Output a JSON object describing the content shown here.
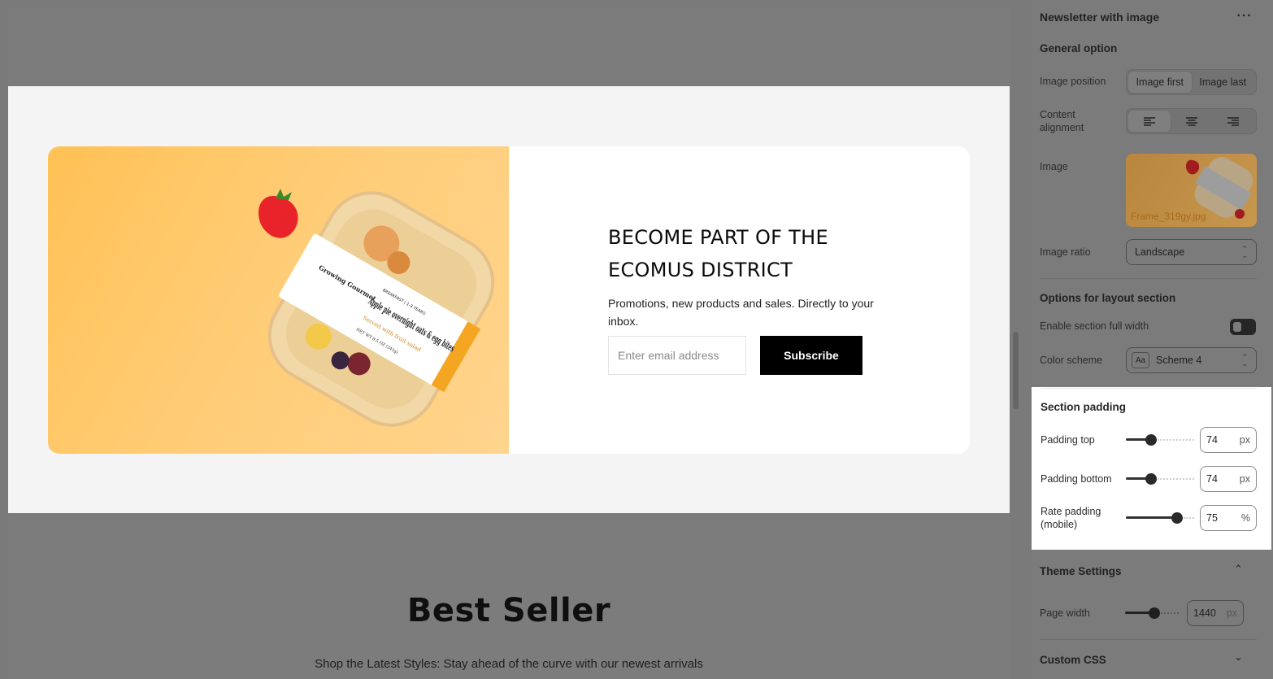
{
  "preview": {
    "newsletter": {
      "heading": "BECOME PART OF THE\nECOMUS DISTRICT",
      "subtext": "Promotions, new products and sales. Directly to your inbox.",
      "email_placeholder": "Enter email address",
      "subscribe_label": "Subscribe",
      "product_image": {
        "brand": "Growing Gourmet",
        "tag": "BREAKFAST | 1-3 YEARS",
        "title": "Apple pie overnight oats & egg bites",
        "subtitle": "Served with fruit salad",
        "weight": "NET WT 8.5 OZ (241g)"
      }
    },
    "best_seller_title": "Best Seller",
    "best_seller_subtitle": "Shop the Latest Styles: Stay ahead of the curve with our newest arrivals"
  },
  "panel": {
    "section_title": "Newsletter with image",
    "more_icon": "more-horizontal-icon",
    "general_heading": "General option",
    "image_position": {
      "label": "Image position",
      "options": [
        "Image first",
        "Image last"
      ],
      "selected": "Image first"
    },
    "content_alignment": {
      "label": "Content alignment",
      "options": [
        "align-left-icon",
        "align-center-icon",
        "align-right-icon"
      ],
      "selected": "align-left-icon"
    },
    "image": {
      "label": "Image",
      "filename": "Frame_319gy.jpg"
    },
    "image_ratio": {
      "label": "Image ratio",
      "value": "Landscape"
    },
    "layout_heading": "Options for layout section",
    "full_width": {
      "label": "Enable section full width",
      "enabled": false
    },
    "color_scheme": {
      "label": "Color scheme",
      "badge": "Aa",
      "value": "Scheme 4"
    },
    "section_padding": {
      "heading": "Section padding",
      "padding_top": {
        "label": "Padding top",
        "value": "74",
        "unit": "px",
        "level": 0.37
      },
      "padding_bottom": {
        "label": "Padding bottom",
        "value": "74",
        "unit": "px",
        "level": 0.37
      },
      "rate_padding": {
        "label": "Rate padding (mobile)",
        "value": "75",
        "unit": "%",
        "level": 0.75
      }
    },
    "theme_settings": {
      "heading": "Theme Settings",
      "page_width": {
        "label": "Page width",
        "value": "1440",
        "unit": "px",
        "level": 0.55
      }
    },
    "custom_css_heading": "Custom CSS"
  }
}
